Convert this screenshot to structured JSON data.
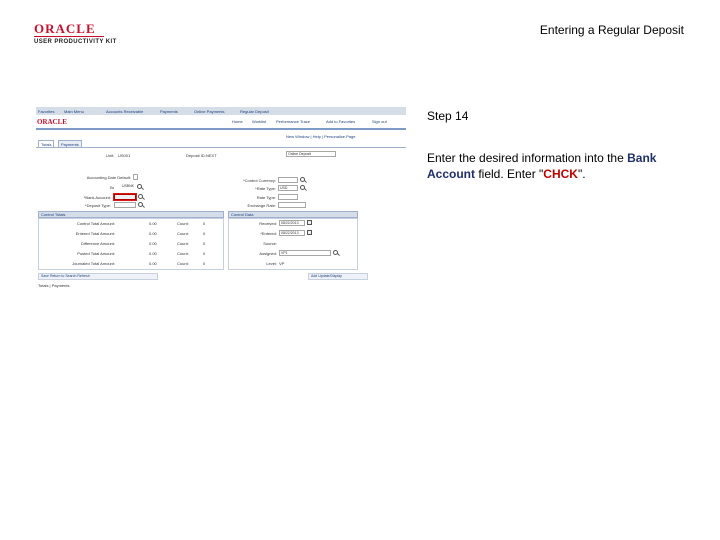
{
  "slide": {
    "title": "Entering a Regular Deposit",
    "logo_brand": "ORACLE",
    "logo_sub": "USER PRODUCTIVITY KIT",
    "step": "Step 14",
    "instruction_pre": "Enter the desired information into the ",
    "instruction_field": "Bank Account",
    "instruction_mid": " field. Enter \"",
    "instruction_value": "CHCK",
    "instruction_post": "\"."
  },
  "app": {
    "breadcrumbs": [
      "Favorites",
      "Main Menu",
      "Accounts Receivable",
      "Payments",
      "Online Payments",
      "Regular Deposit"
    ],
    "logo": "ORACLE",
    "top_links": [
      "Home",
      "Worklist",
      "Performance Trace",
      "Add to Favorites",
      "Sign out"
    ],
    "new_window": "New Window | Help | Personalize Page",
    "tabs": [
      "Totals",
      "Payments"
    ],
    "header": {
      "unit_label": "Unit:",
      "unit_value": "US001",
      "deposit_label": "Deposit ID:",
      "deposit_value": "NEXT",
      "status_value": "Online Deposit"
    },
    "fields_left": [
      {
        "label": "Accounting Date Default:",
        "value": ""
      },
      {
        "label": "Bank Code:",
        "value": "USBNK"
      },
      {
        "label": "*Bank Account:",
        "value": ""
      },
      {
        "label": "*Deposit Type:",
        "value": ""
      }
    ],
    "fields_right": [
      {
        "label": "*Control Currency:",
        "value": ""
      },
      {
        "label": "*Rate Type:",
        "value": "USD"
      },
      {
        "label": "Rate Type:",
        "value": ""
      },
      {
        "label": "Exchange Rate:",
        "value": ""
      }
    ],
    "control_totals": {
      "title": "Control Totals",
      "rows": [
        {
          "label": "Control Total Amount:",
          "amount": "0.00",
          "count_label": "Count:",
          "count": "0"
        },
        {
          "label": "Entered Total Amount:",
          "amount": "0.00",
          "count_label": "Count:",
          "count": "0"
        },
        {
          "label": "Difference Amount:",
          "amount": "0.00",
          "count_label": "Count:",
          "count": "0"
        },
        {
          "label": "Posted Total Amount:",
          "amount": "0.00",
          "count_label": "Count:",
          "count": "0"
        },
        {
          "label": "Journaled Total Amount:",
          "amount": "0.00",
          "count_label": "Count:",
          "count": "0"
        }
      ]
    },
    "control_data": {
      "title": "Control Data",
      "rows": [
        {
          "label": "Received:",
          "value": "08/22/2013"
        },
        {
          "label": "*Entered:",
          "value": "08/22/2013"
        },
        {
          "label": "Source:",
          "value": ""
        },
        {
          "label": "Assigned:",
          "value": "VP1"
        },
        {
          "label": "Level:",
          "value": "VP"
        }
      ]
    },
    "buttons_left": "Save    Return to Search    Refresh",
    "buttons_right": "Add    Update/Display",
    "footer": "Totals | Payments"
  }
}
